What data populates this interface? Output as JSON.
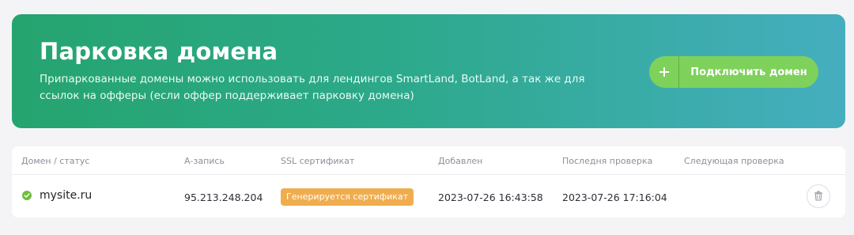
{
  "banner": {
    "title": "Парковка домена",
    "description": "Припаркованные домены можно использовать для лендингов SmartLand, BotLand, а так же для ссылок на офферы (если оффер поддерживает парковку домена)",
    "connect_button": {
      "icon": "plus-icon",
      "label": "Подключить домен"
    },
    "gradient_start": "#25a46f",
    "gradient_end": "#45aebf",
    "button_color": "#7ed15b"
  },
  "table": {
    "headers": {
      "domain_status": "Домен / статус",
      "a_record": "А-запись",
      "ssl": "SSL сертификат",
      "added": "Добавлен",
      "last_check": "Последня проверка",
      "next_check": "Следующая проверка"
    },
    "rows": [
      {
        "status_icon": "check-circle-icon",
        "status_color": "#6fbf3a",
        "domain": "mysite.ru",
        "a_record": "95.213.248.204",
        "ssl_status": "Генерируется сертификат",
        "ssl_badge_color": "#f0ad4e",
        "added": "2023-07-26 16:43:58",
        "last_check": "2023-07-26 17:16:04",
        "next_check": "",
        "delete_icon": "trash-icon"
      }
    ]
  }
}
